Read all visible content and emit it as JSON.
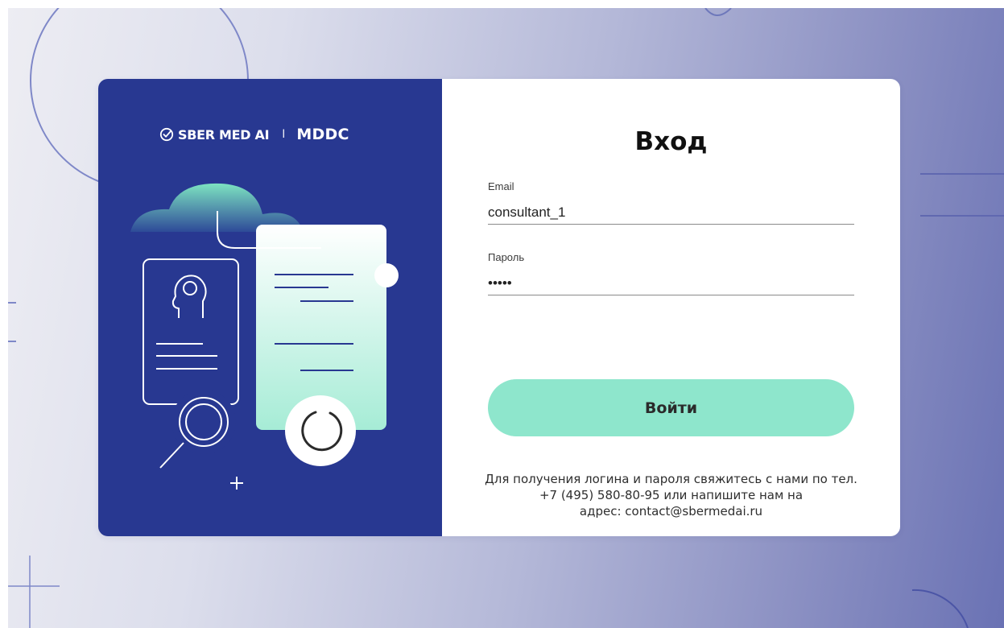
{
  "brand": {
    "name": "SBER MED AI",
    "separator": "I",
    "product": "MDDC"
  },
  "login_form": {
    "title": "Вход",
    "email": {
      "label": "Email",
      "value": "consultant_1"
    },
    "password": {
      "label": "Пароль",
      "value": "•••••"
    },
    "submit_label": "Войти"
  },
  "help": {
    "line1": "Для получения логина и пароля свяжитесь с нами по тел.",
    "line2": "+7 (495) 580-80-95 или напишите нам на",
    "line3": "адрес: contact@sbermedai.ru"
  },
  "colors": {
    "panel_blue": "#283891",
    "accent_mint": "#8ee6cc",
    "background_gradient_end": "#6a72b4"
  },
  "icons": {
    "brand_logo": "check-circle-icon",
    "illustration_items": [
      "cloud-icon",
      "document-icon",
      "head-icon",
      "magnifier-icon",
      "loading-spinner-icon",
      "plus-icon"
    ]
  }
}
